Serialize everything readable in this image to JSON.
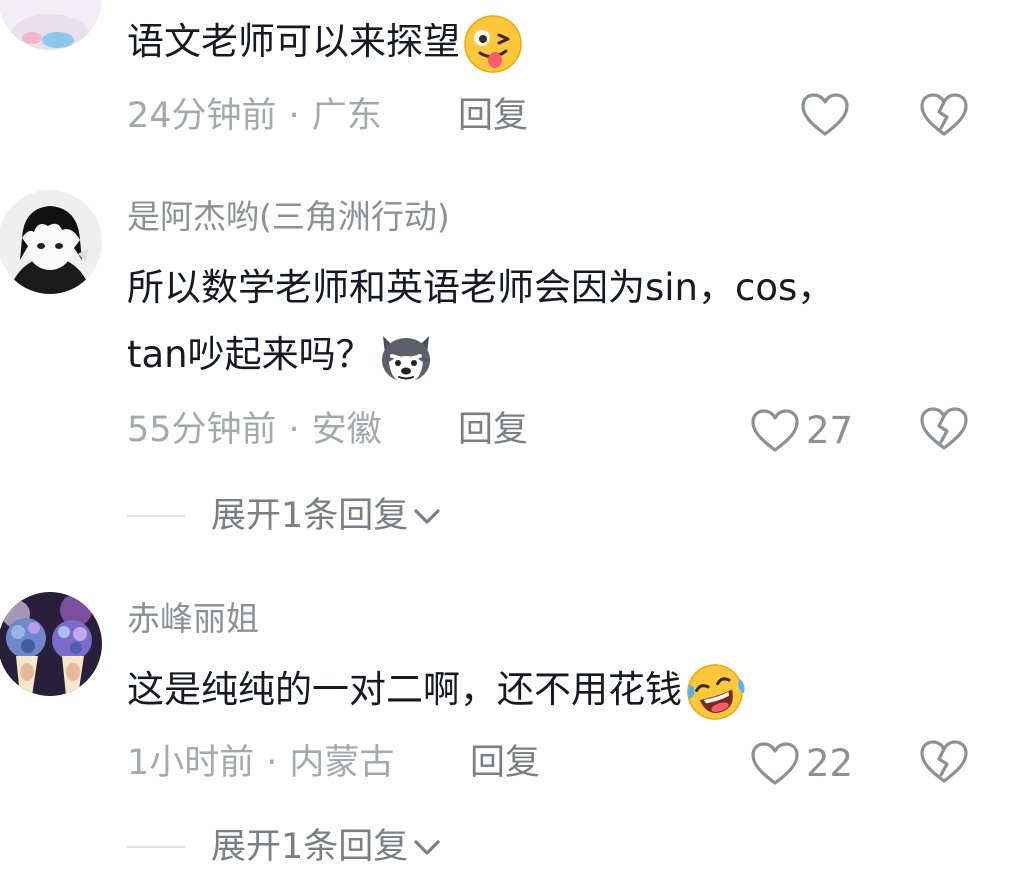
{
  "comments": [
    {
      "text": "语文老师可以来探望",
      "emoji": "wink-tongue-emoji",
      "time": "24分钟前",
      "location": "广东",
      "reply_label": "回复",
      "likes": ""
    },
    {
      "username": "是阿杰哟(三角洲行动)",
      "text_line1": "所以数学老师和英语老师会因为sin，cos，",
      "text_line2": "tan吵起来吗？",
      "emoji": "husky-dog-emoji",
      "time": "55分钟前",
      "location": "安徽",
      "reply_label": "回复",
      "likes": "27",
      "expand_label": "展开1条回复"
    },
    {
      "username": "赤峰丽姐",
      "text": "这是纯纯的一对二啊，还不用花钱",
      "emoji": "laughing-tears-emoji",
      "time": "1小时前",
      "location": "内蒙古",
      "reply_label": "回复",
      "likes": "22",
      "expand_label": "展开1条回复"
    }
  ],
  "separator": "·",
  "colors": {
    "text": "#161823",
    "username": "#8f9097",
    "meta": "#a7a8ae",
    "icon": "#8f9097"
  }
}
